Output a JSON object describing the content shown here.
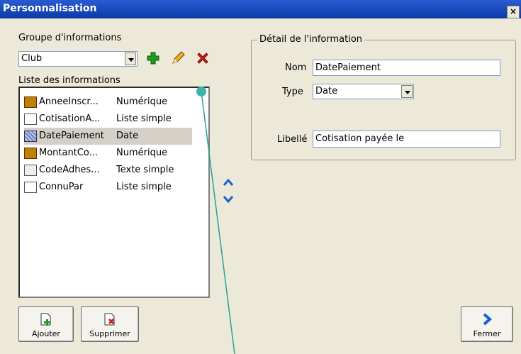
{
  "window": {
    "title": "Personnalisation",
    "close_label": "×"
  },
  "left": {
    "groupe_label": "Groupe d'informations",
    "groupe_value": "Club",
    "liste_label": "Liste des informations",
    "items": [
      {
        "name": "AnneeInscr...",
        "type": "Numérique",
        "icon": "numeric-icon"
      },
      {
        "name": "CotisationA...",
        "type": "Liste simple",
        "icon": "list-icon"
      },
      {
        "name": "DatePaiement",
        "type": "Date",
        "icon": "date-icon"
      },
      {
        "name": "MontantCo...",
        "type": "Numérique",
        "icon": "numeric-icon"
      },
      {
        "name": "CodeAdhes...",
        "type": "Texte simple",
        "icon": "text-icon"
      },
      {
        "name": "ConnuPar",
        "type": "Liste simple",
        "icon": "list-icon"
      }
    ],
    "selected_index": 2
  },
  "detail": {
    "legend": "Détail de l'information",
    "nom_label": "Nom",
    "nom_value": "DatePaiement",
    "type_label": "Type",
    "type_value": "Date",
    "libelle_label": "Libellé",
    "libelle_value": "Cotisation payée le"
  },
  "buttons": {
    "ajouter": "Ajouter",
    "supprimer": "Supprimer",
    "fermer": "Fermer"
  },
  "colors": {
    "accent_blue": "#1a5fcf",
    "add_green": "#1e9a1e",
    "delete_red": "#d02020",
    "annotation_teal": "#2aa198"
  }
}
